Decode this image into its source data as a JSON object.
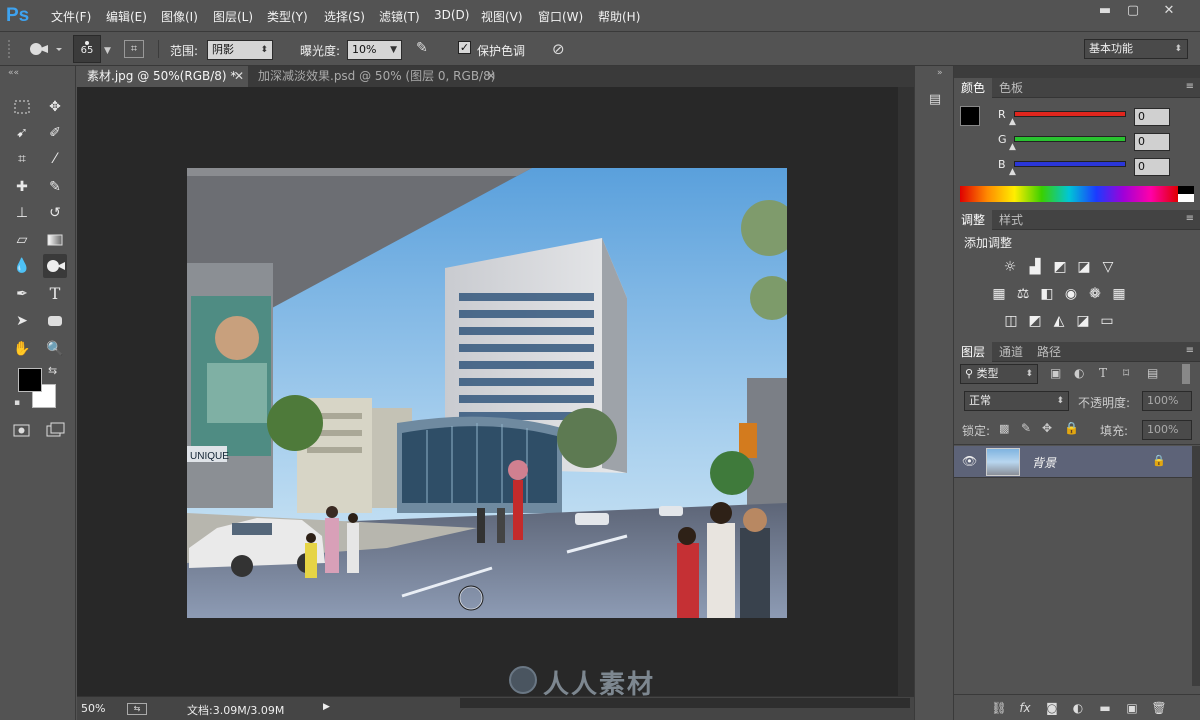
{
  "app": {
    "logo": "Ps"
  },
  "menu": [
    "文件(F)",
    "编辑(E)",
    "图像(I)",
    "图层(L)",
    "类型(Y)",
    "选择(S)",
    "滤镜(T)",
    "3D(D)",
    "视图(V)",
    "窗口(W)",
    "帮助(H)"
  ],
  "window_controls": {
    "minimize": "▬",
    "restore": "▢",
    "close": "✕"
  },
  "options": {
    "brush_size": "65",
    "range_label": "范围:",
    "range_value": "阴影",
    "exposure_label": "曝光度:",
    "exposure_value": "10%",
    "protect_label": "保护色调",
    "protect_checked": true,
    "workspace": "基本功能"
  },
  "tabs": [
    {
      "label": "素材.jpg @ 50%(RGB/8) *",
      "active": true
    },
    {
      "label": "加深减淡效果.psd @ 50% (图层 0, RGB/8)",
      "active": false
    }
  ],
  "status": {
    "zoom": "50%",
    "doc": "文档:3.09M/3.09M"
  },
  "canvas": {
    "billboard_text": "UNIQUE"
  },
  "color_panel": {
    "tabs": [
      "颜色",
      "色板"
    ],
    "channels": [
      {
        "label": "R",
        "value": "0",
        "color": "#e0261d"
      },
      {
        "label": "G",
        "value": "0",
        "color": "#29c230"
      },
      {
        "label": "B",
        "value": "0",
        "color": "#2a36d8"
      }
    ],
    "foreground": "#000000",
    "background": "#ffffff"
  },
  "adjust_panel": {
    "tabs": [
      "调整",
      "样式"
    ],
    "title": "添加调整"
  },
  "layers_panel": {
    "tabs": [
      "图层",
      "通道",
      "路径"
    ],
    "filter": "类型",
    "blend_mode": "正常",
    "opacity_label": "不透明度:",
    "opacity": "100%",
    "lock_label": "锁定:",
    "fill_label": "填充:",
    "fill": "100%",
    "layers": [
      {
        "name": "背景",
        "visible": true,
        "locked": true
      }
    ]
  },
  "watermark": {
    "text": "人人素材"
  }
}
